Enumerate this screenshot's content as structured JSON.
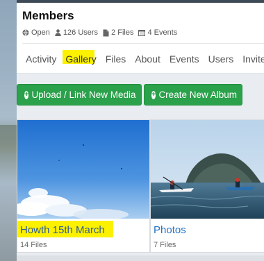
{
  "group": {
    "title": "Members",
    "meta": {
      "privacy": "Open",
      "users": "126 Users",
      "files": "2 Files",
      "events": "4 Events"
    }
  },
  "tabs": [
    {
      "label": "Activity"
    },
    {
      "label": "Gallery",
      "active": true
    },
    {
      "label": "Files"
    },
    {
      "label": "About"
    },
    {
      "label": "Events"
    },
    {
      "label": "Users"
    },
    {
      "label": "Invites"
    }
  ],
  "actions": {
    "upload_label": "Upload / Link New Media",
    "create_album_label": "Create New Album"
  },
  "albums": [
    {
      "name": "Howth 15th March",
      "count": "14 Files",
      "highlighted": true
    },
    {
      "name": "Photos",
      "count": "7 Files"
    }
  ],
  "colors": {
    "accent_green": "#2aa14a",
    "highlight_yellow": "#fbf100",
    "link_blue": "#1f73c7"
  },
  "icons": [
    "globe-icon",
    "user-icon",
    "file-icon",
    "calendar-icon",
    "plus-circle-icon"
  ]
}
